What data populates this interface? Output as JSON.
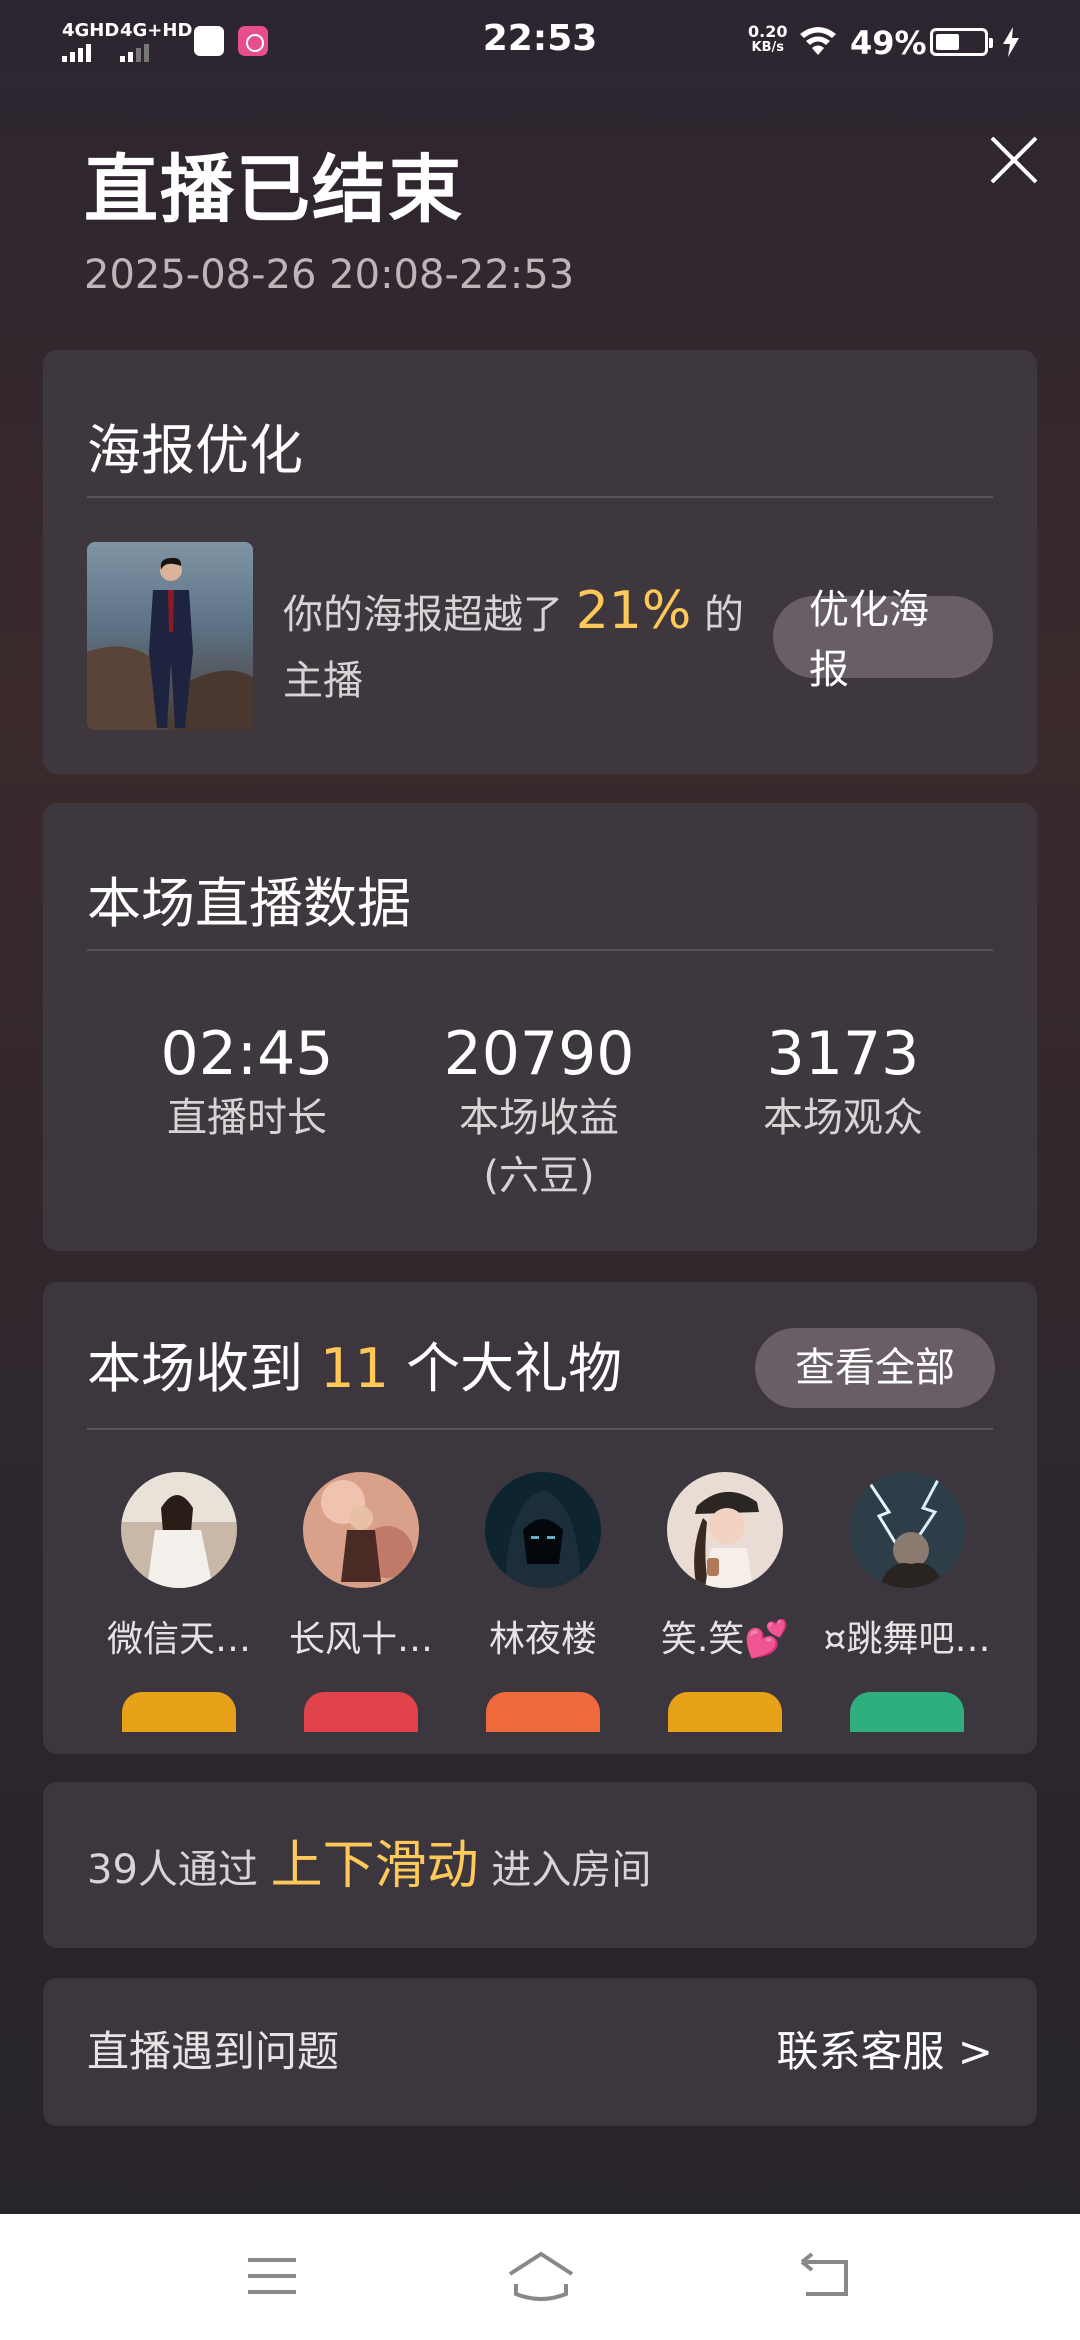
{
  "status_bar": {
    "time": "22:53",
    "sim1": "4GHD",
    "sim2": "4G+HD",
    "net_speed_value": "0.20",
    "net_speed_unit": "KB/s",
    "battery": "49%",
    "battery_level": 0.49
  },
  "header": {
    "title": "直播已结束",
    "time_range": "2025-08-26 20:08-22:53"
  },
  "poster": {
    "title": "海报优化",
    "text_before": "你的海报超越了",
    "percent": "21%",
    "text_after": "的主播",
    "button": "优化海报"
  },
  "stats": {
    "title": "本场直播数据",
    "items": [
      {
        "value": "02:45",
        "label": "直播时长",
        "sub": ""
      },
      {
        "value": "20790",
        "label": "本场收益",
        "sub": "(六豆)"
      },
      {
        "value": "3173",
        "label": "本场观众",
        "sub": ""
      }
    ]
  },
  "gifts": {
    "title_before": "本场收到",
    "count": "11",
    "title_after": "个大礼物",
    "view_all": "查看全部",
    "users": [
      {
        "name": "微信天…",
        "badge_color": "#e8a21a"
      },
      {
        "name": "长风十…",
        "badge_color": "#e0434a"
      },
      {
        "name": "林夜楼",
        "badge_color": "#ee6a3a"
      },
      {
        "name": "笑.笑💕",
        "badge_color": "#e8a21a"
      },
      {
        "name": "¤跳舞吧…",
        "badge_color": "#2fae7e"
      }
    ]
  },
  "slide": {
    "before": "39人通过",
    "highlight": "上下滑动",
    "after": "进入房间"
  },
  "problem": {
    "label": "直播遇到问题",
    "link": "联系客服 >"
  },
  "colors": {
    "accent": "#ffc95a",
    "card_bg": "#403942"
  }
}
